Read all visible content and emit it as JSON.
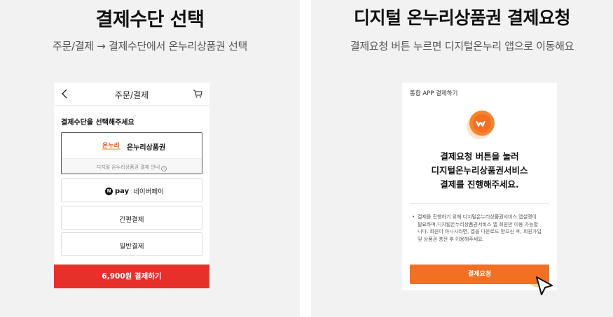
{
  "left": {
    "title": "결제수단 선택",
    "subtitle": "주문/결제 → 결제수단에서 온누리상품권 선택",
    "header": {
      "title": "주문/결제"
    },
    "section_title": "결제수단을 선택해주세요",
    "onnuri": {
      "logo_text": "온누리",
      "name": "온누리상품권",
      "guide": "디지털 온누리상품권 결제 안내",
      "info_glyph": "i"
    },
    "naverpay": {
      "logo_letter": "N",
      "logo_word": "pay",
      "name": "네이버페이"
    },
    "easy_pay": "간편결제",
    "general_pay": "일반결제",
    "cta": "6,900원 결제하기"
  },
  "right": {
    "title": "디지털 온누리상품권 결제요청",
    "subtitle": "결제요청 버튼 누르면 디지털온누리 앱으로 이동해요",
    "header": "통합 APP 결제하기",
    "message_line1": "결제요청 버튼을 눌러",
    "message_line2": "디지털온누리상품권서비스",
    "message_line3": "결제를 진행해주세요.",
    "note": "결제를 진행하기 위해 디지털온누리상품권서비스 앱설맹이 필요하며,디지털온누리상품권서비스 앱 회원만 이용 가능합니다. 회원이 아니시라면, 앱을 다운로드 받으신 후, 회원가입 및 상품권 충전 후 이용해주세요.",
    "cta": "결제요청"
  },
  "colors": {
    "accent_red": "#e8302a",
    "accent_orange": "#f37022",
    "panel_bg": "#f2f2f2"
  }
}
